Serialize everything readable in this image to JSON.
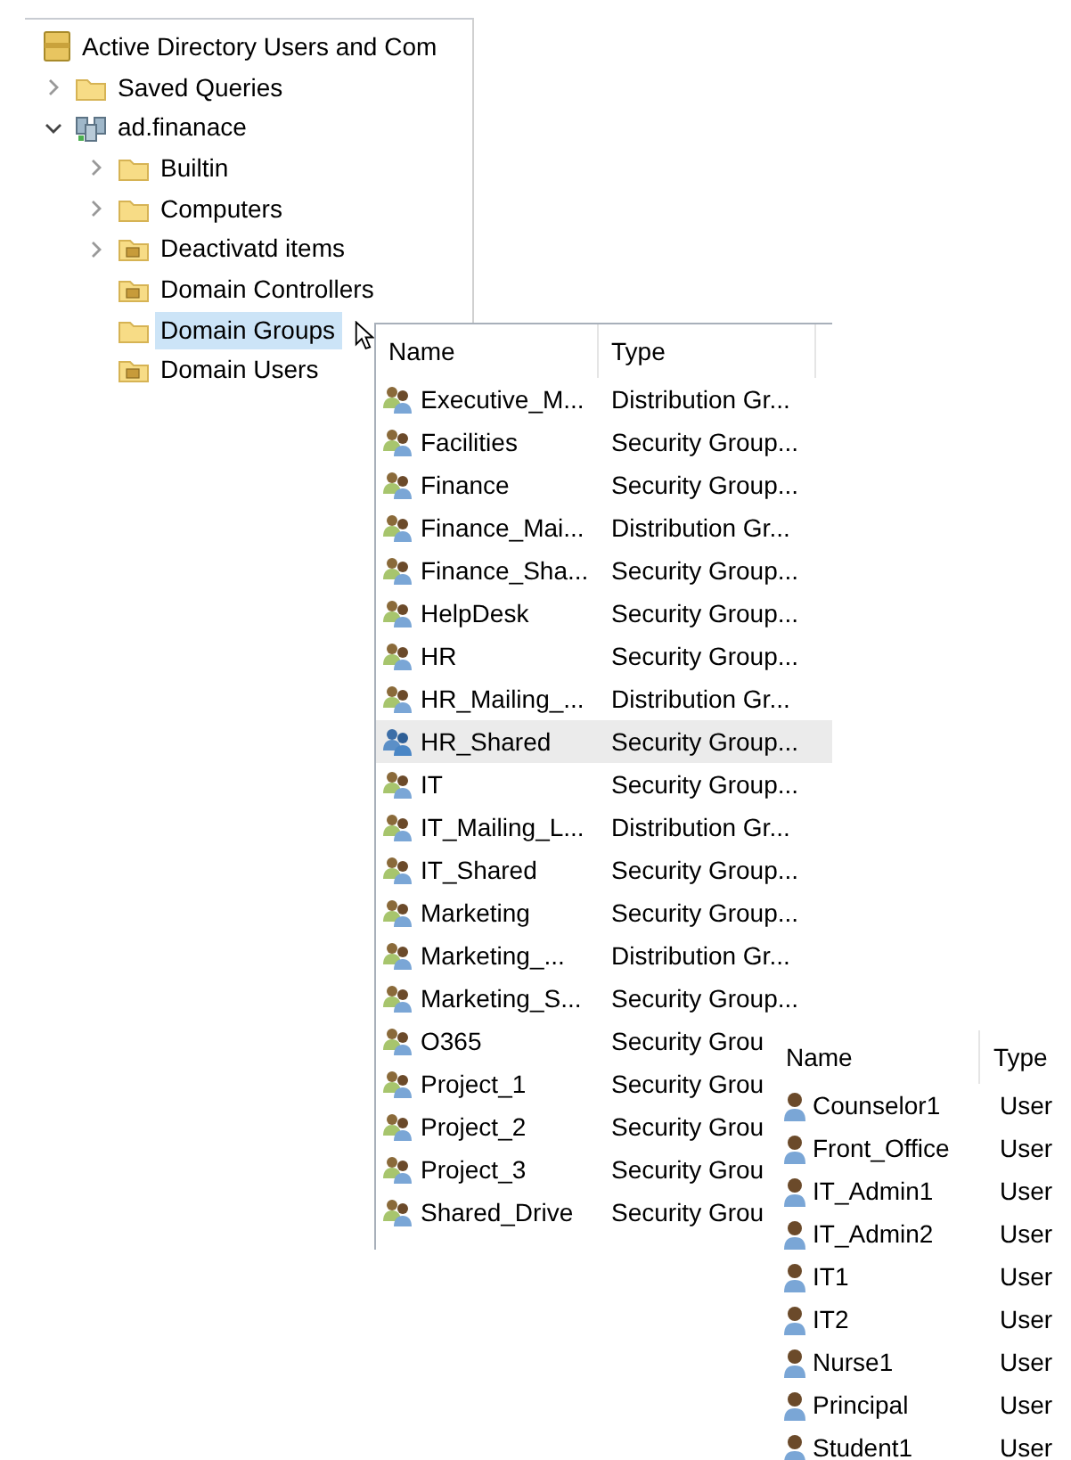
{
  "tree": {
    "label": "Active Directory Users and Com",
    "kind": "root",
    "children": [
      {
        "label": "Saved Queries",
        "kind": "folder",
        "expanded": false,
        "selected": false
      },
      {
        "label": "ad.finanace",
        "kind": "domain",
        "expanded": true,
        "selected": false,
        "children": [
          {
            "label": "Builtin",
            "kind": "folder",
            "expanded": false,
            "selected": false
          },
          {
            "label": "Computers",
            "kind": "folder",
            "expanded": false,
            "selected": false
          },
          {
            "label": "Deactivatd items",
            "kind": "ou",
            "expanded": false,
            "selected": false
          },
          {
            "label": "Domain Controllers",
            "kind": "ou",
            "selected": false
          },
          {
            "label": "Domain Groups",
            "kind": "folder",
            "selected": true
          },
          {
            "label": "Domain Users",
            "kind": "ou",
            "selected": false
          }
        ]
      }
    ]
  },
  "groups_list": {
    "columns": [
      "Name",
      "Type"
    ],
    "rows": [
      {
        "name": "Executive_M...",
        "type": "Distribution Gr...",
        "selected": false
      },
      {
        "name": "Facilities",
        "type": "Security Group...",
        "selected": false
      },
      {
        "name": "Finance",
        "type": "Security Group...",
        "selected": false
      },
      {
        "name": "Finance_Mai...",
        "type": "Distribution Gr...",
        "selected": false
      },
      {
        "name": "Finance_Sha...",
        "type": "Security Group...",
        "selected": false
      },
      {
        "name": "HelpDesk",
        "type": "Security Group...",
        "selected": false
      },
      {
        "name": "HR",
        "type": "Security Group...",
        "selected": false
      },
      {
        "name": "HR_Mailing_...",
        "type": "Distribution Gr...",
        "selected": false
      },
      {
        "name": "HR_Shared",
        "type": "Security Group...",
        "selected": true
      },
      {
        "name": "IT",
        "type": "Security Group...",
        "selected": false
      },
      {
        "name": "IT_Mailing_L...",
        "type": "Distribution Gr...",
        "selected": false
      },
      {
        "name": "IT_Shared",
        "type": "Security Group...",
        "selected": false
      },
      {
        "name": "Marketing",
        "type": "Security Group...",
        "selected": false
      },
      {
        "name": "Marketing_...",
        "type": "Distribution Gr...",
        "selected": false
      },
      {
        "name": "Marketing_S...",
        "type": "Security Group...",
        "selected": false
      },
      {
        "name": "O365",
        "type": "Security Grou",
        "selected": false
      },
      {
        "name": "Project_1",
        "type": "Security Grou",
        "selected": false
      },
      {
        "name": "Project_2",
        "type": "Security Grou",
        "selected": false
      },
      {
        "name": "Project_3",
        "type": "Security Grou",
        "selected": false
      },
      {
        "name": "Shared_Drive",
        "type": "Security Grou",
        "selected": false
      }
    ]
  },
  "users_list": {
    "columns": [
      "Name",
      "Type"
    ],
    "rows": [
      {
        "name": "Counselor1",
        "type": "User"
      },
      {
        "name": "Front_Office",
        "type": "User"
      },
      {
        "name": "IT_Admin1",
        "type": "User"
      },
      {
        "name": "IT_Admin2",
        "type": "User"
      },
      {
        "name": "IT1",
        "type": "User"
      },
      {
        "name": "IT2",
        "type": "User"
      },
      {
        "name": "Nurse1",
        "type": "User"
      },
      {
        "name": "Principal",
        "type": "User"
      },
      {
        "name": "Student1",
        "type": "User"
      }
    ]
  }
}
